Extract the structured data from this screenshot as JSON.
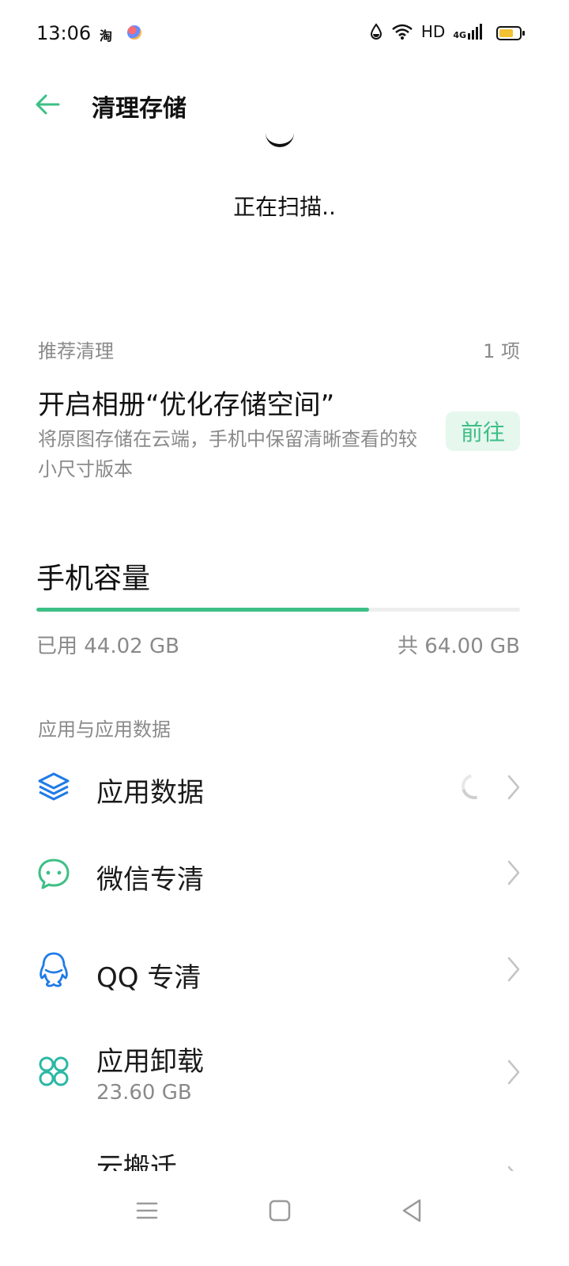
{
  "status_bar": {
    "time": "13:06",
    "app_icon_1": "淘",
    "network": "HD",
    "network_type": "4G"
  },
  "header": {
    "title": "清理存储",
    "back_icon": "arrow-left-icon"
  },
  "scan": {
    "status_text": "正在扫描.."
  },
  "recommend": {
    "section_label": "推荐清理",
    "count": "1 项",
    "card": {
      "title": "开启相册“优化存储空间”",
      "description": "将原图存储在云端，手机中保留清晰查看的较小尺寸版本",
      "action_label": "前往"
    }
  },
  "capacity": {
    "title": "手机容量",
    "used_label": "已用 44.02 GB",
    "total_label": "共 64.00 GB",
    "used_fraction": 0.688
  },
  "apps_section": {
    "label": "应用与应用数据",
    "items": [
      {
        "label": "应用数据",
        "icon": "layers-icon",
        "sub": "",
        "loading": true
      },
      {
        "label": "微信专清",
        "icon": "chat-bubble-icon",
        "sub": ""
      },
      {
        "label": "QQ 专清",
        "icon": "qq-penguin-icon",
        "sub": ""
      },
      {
        "label": "应用卸载",
        "icon": "app-grid-icon",
        "sub": "23.60 GB"
      },
      {
        "label": "云搬迁",
        "icon": "cloud-icon",
        "sub": ""
      }
    ]
  },
  "colors": {
    "accent": "#3dbf85",
    "accent_bg": "#e6f7ee",
    "blue": "#1f7be8",
    "text_primary": "#1a1a1a",
    "text_secondary": "#8a8a8a"
  }
}
